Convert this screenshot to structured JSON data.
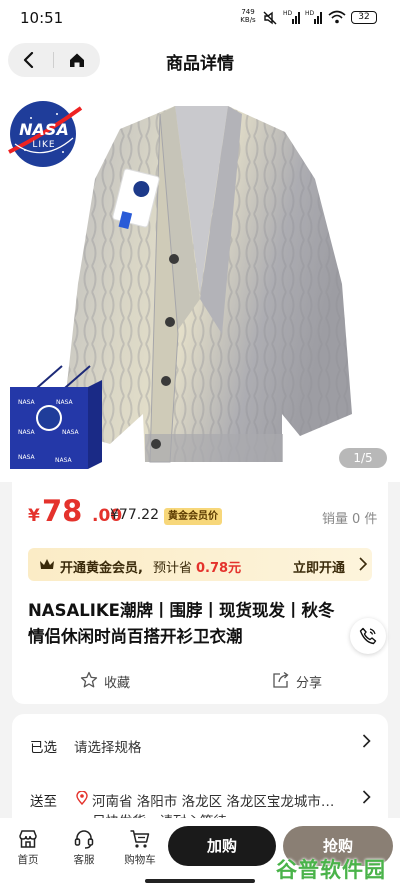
{
  "status_bar": {
    "time": "10:51",
    "net_speed": "749",
    "net_unit": "KB/s",
    "battery": "32"
  },
  "header": {
    "title": "商品详情"
  },
  "gallery": {
    "counter": "1/5",
    "badge_top": "NASA",
    "badge_bottom": "LIKE",
    "bag_badge_top": "NASA",
    "bag_badge_bottom": "LIKE"
  },
  "price": {
    "symbol": "¥",
    "integer": "78",
    "decimal": ".00",
    "member_price": "¥77.22",
    "member_tag": "黄金会员价",
    "sales_label": "销量",
    "sales_count": "0 件"
  },
  "vip_bar": {
    "label": "开通黄金会员,",
    "estimate_label": "预计省",
    "estimate_value": "0.78元",
    "action": "立即开通"
  },
  "product": {
    "title_line1": "NASALIKE潮牌丨围脖丨现货现发丨秋冬",
    "title_line2": "情侣休闲时尚百搭开衫卫衣潮"
  },
  "actions": {
    "favorite": "收藏",
    "share": "分享"
  },
  "spec": {
    "selected_label": "已选",
    "selected_value": "请选择规格",
    "ship_label": "送至",
    "ship_value": "河南省 洛阳市 洛龙区 洛龙区宝龙城市…",
    "ship_note": "尽快发货，请耐心等待"
  },
  "bottom_bar": {
    "home": "首页",
    "service": "客服",
    "cart": "购物车",
    "buy": "加购",
    "grab": "抢购",
    "watermark": "谷普软件园"
  },
  "colors": {
    "price_red": "#e4322c",
    "gold": "#f7d77a",
    "buy_btn": "#1a1a1a",
    "grab_btn": "#8a7f74",
    "watermark_green": "#4ab34a"
  }
}
